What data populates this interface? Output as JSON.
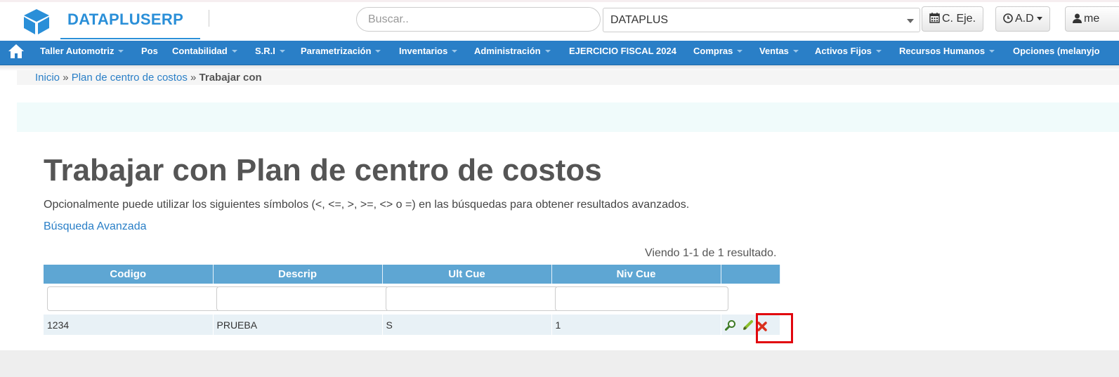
{
  "header": {
    "brand": "DATAPLUSERP",
    "search_placeholder": "Buscar..",
    "company_selected": "DATAPLUS",
    "btn_ejercicio": "C. Eje.",
    "btn_user_short": "A.D",
    "btn_user": "me"
  },
  "nav": {
    "items": [
      {
        "label": "Taller Automotriz"
      },
      {
        "label": "Pos"
      },
      {
        "label": "Contabilidad"
      },
      {
        "label": "S.R.I"
      },
      {
        "label": "Parametrización"
      },
      {
        "label": "Inventarios"
      },
      {
        "label": "Administración"
      },
      {
        "label": "EJERCICIO FISCAL 2024"
      },
      {
        "label": "Compras"
      },
      {
        "label": "Ventas"
      },
      {
        "label": "Activos Fijos"
      },
      {
        "label": "Recursos Humanos"
      },
      {
        "label": "Opciones (melanyjo"
      }
    ]
  },
  "breadcrumb": {
    "home": "Inicio",
    "sep": "»",
    "parent": "Plan de centro de costos",
    "current": "Trabajar con"
  },
  "main": {
    "title": "Trabajar con Plan de centro de costos",
    "description": "Opcionalmente puede utilizar los siguientes símbolos (<, <=, >, >=, <> o =) en las búsquedas para obtener resultados avanzados.",
    "advanced_link": "Búsqueda Avanzada",
    "summary": "Viendo 1-1 de 1 resultado."
  },
  "table": {
    "headers": [
      "Codigo",
      "Descrip",
      "Ult Cue",
      "Niv Cue",
      ""
    ],
    "rows": [
      {
        "codigo": "1234",
        "descrip": "PRUEBA",
        "ult_cue": "S",
        "niv_cue": "1"
      }
    ]
  },
  "colors": {
    "brand": "#2a8fd8",
    "nav_bg": "#2a7fc7",
    "table_header": "#5ea6d3",
    "highlight": "#e1060e"
  },
  "icons": [
    "cube-logo-icon",
    "home-icon",
    "calendar-icon",
    "clock-icon",
    "user-icon",
    "view-icon",
    "edit-icon",
    "delete-icon"
  ]
}
